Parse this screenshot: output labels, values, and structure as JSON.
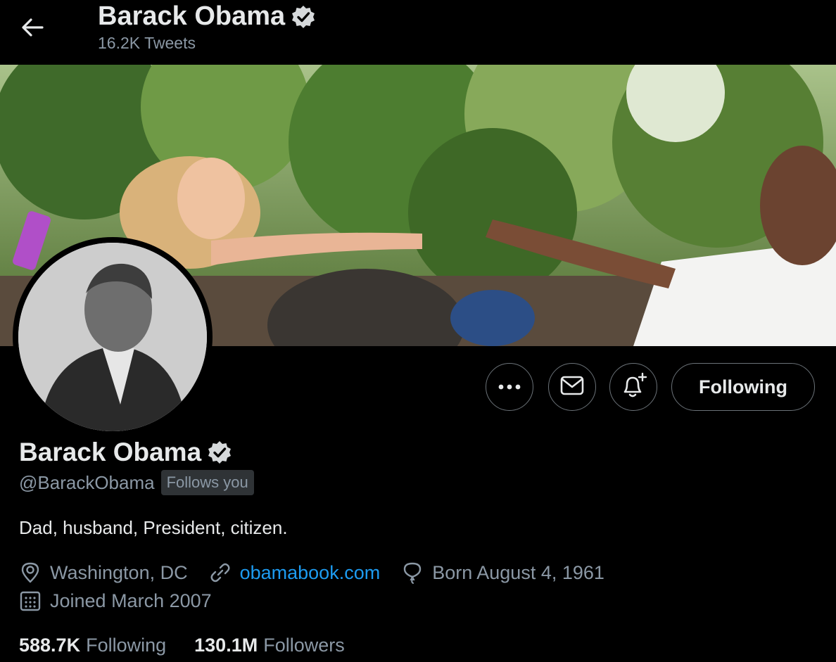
{
  "header": {
    "name": "Barack Obama",
    "tweet_count": "16.2K",
    "tweet_label": "Tweets"
  },
  "actions": {
    "following_label": "Following"
  },
  "profile": {
    "name": "Barack Obama",
    "handle": "@BarackObama",
    "follows_you": "Follows you",
    "bio": "Dad, husband, President, citizen.",
    "location": "Washington, DC",
    "website": "obamabook.com",
    "birthday": "Born August 4, 1961",
    "joined": "Joined March 2007"
  },
  "stats": {
    "following_count": "588.7K",
    "following_label": "Following",
    "followers_count": "130.1M",
    "followers_label": "Followers"
  },
  "icons": {
    "back": "arrow-left-icon",
    "verified": "verified-badge-icon",
    "more": "more-dots-icon",
    "message": "envelope-icon",
    "notify": "bell-plus-icon",
    "location": "location-pin-icon",
    "link": "link-icon",
    "birthday": "balloon-icon",
    "calendar": "calendar-icon"
  },
  "colors": {
    "background": "#000000",
    "text_primary": "#e7e9ea",
    "text_secondary": "#8b98a5",
    "link": "#1d9bf0",
    "badge_bg": "#2f3336"
  }
}
